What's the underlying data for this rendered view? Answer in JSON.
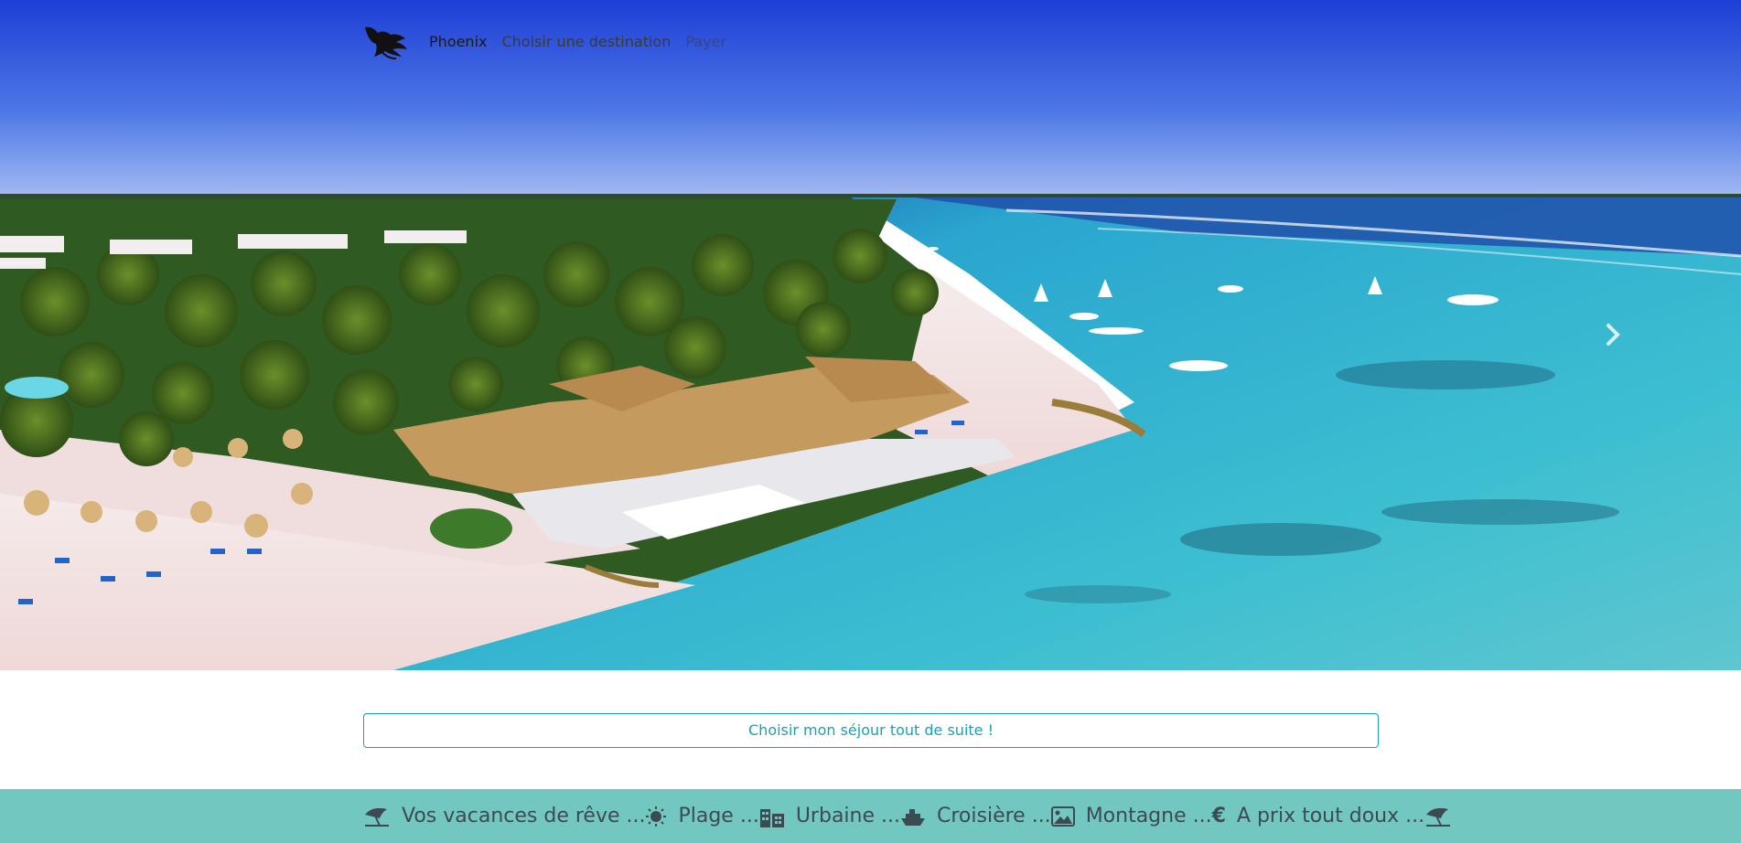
{
  "nav": {
    "brand": "Phoenix",
    "links": [
      "Choisir une destination",
      "Payer"
    ],
    "logo_icon": "phoenix-bird-logo"
  },
  "carousel": {
    "next_icon": "chevron-right-icon"
  },
  "cta": {
    "label": "Choisir mon séjour tout de suite !"
  },
  "band": {
    "items": [
      {
        "icon": "beach-umbrella-icon",
        "label": "Vos vacances de rêve ..."
      },
      {
        "icon": "sun-icon",
        "label": "Plage ..."
      },
      {
        "icon": "city-icon",
        "label": "Urbaine ..."
      },
      {
        "icon": "ship-icon",
        "label": "Croisière ..."
      },
      {
        "icon": "image-icon",
        "label": "Montagne ..."
      },
      {
        "icon": "euro-icon",
        "label": "A prix tout doux ..."
      }
    ],
    "trailing_icon": "beach-umbrella-icon"
  },
  "colors": {
    "accent": "#17a2b8",
    "band": "#72c8c0",
    "sky_top": "#1f4fe0",
    "sky_bottom": "#9bb3f0",
    "sea": "#2fb7c9",
    "sand": "#f3e6e6"
  }
}
